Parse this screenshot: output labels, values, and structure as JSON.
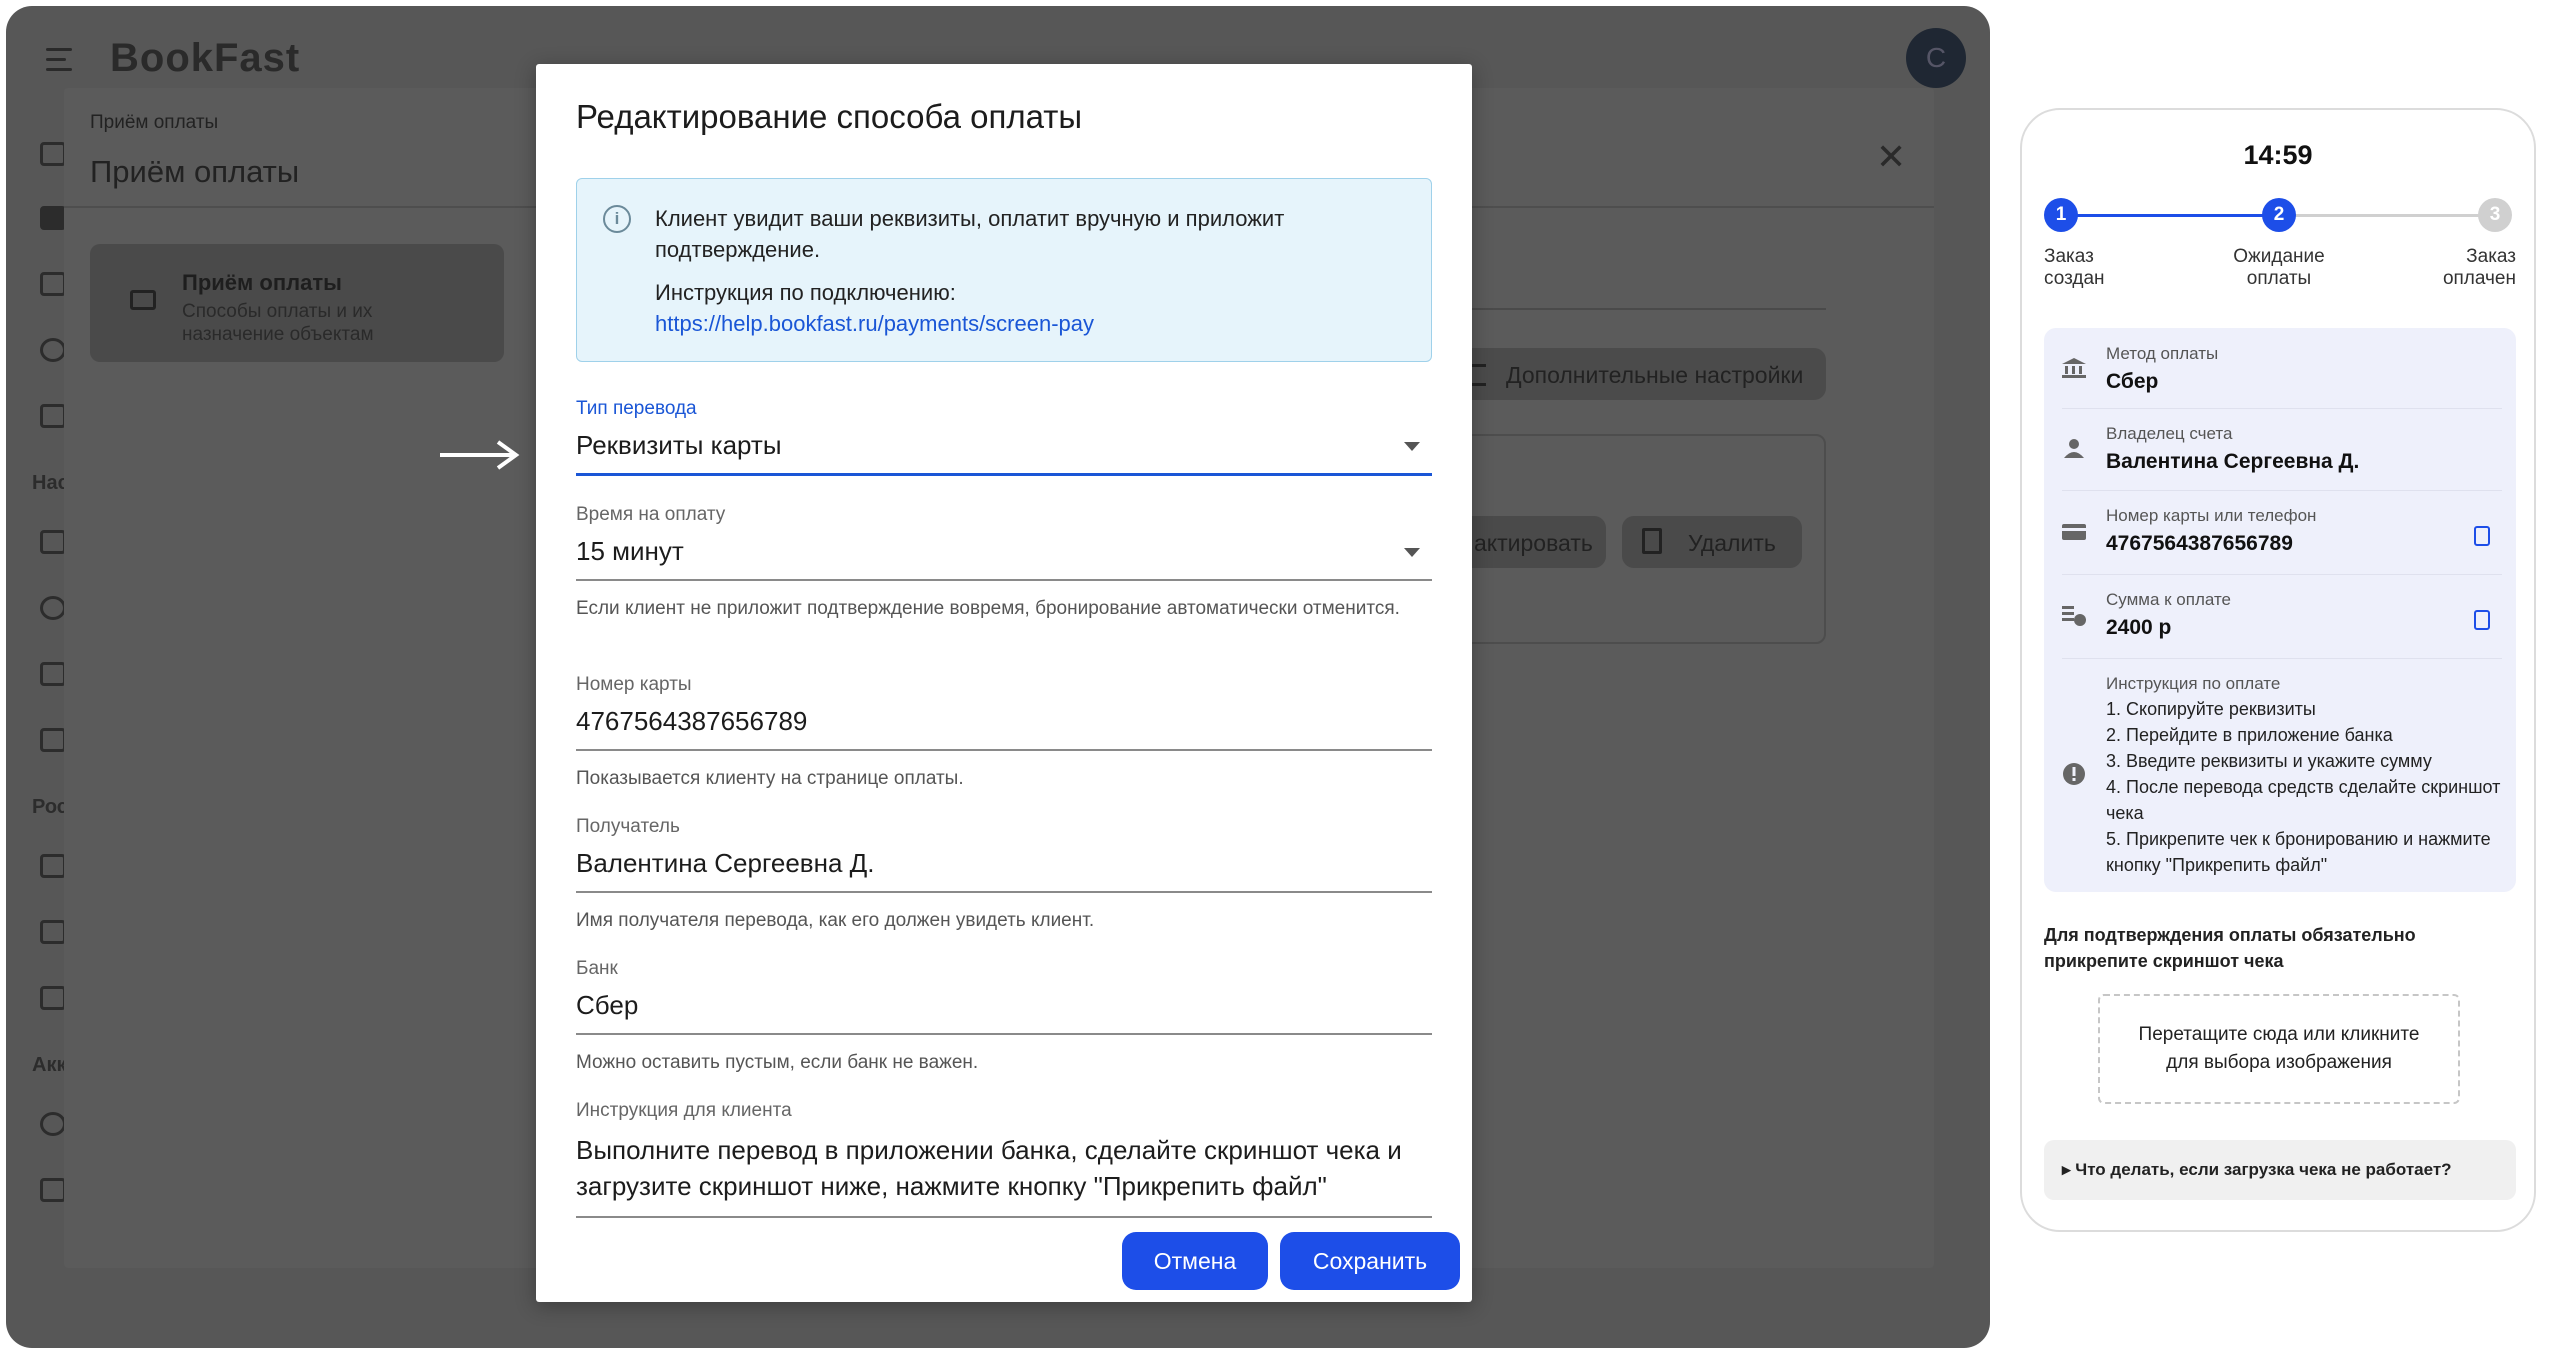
{
  "app": {
    "brand": "BookFast",
    "avatar_letter": "C"
  },
  "sidebar": {
    "section_1": "Нас",
    "section_2": "Рос",
    "section_3": "Акк"
  },
  "background_page": {
    "breadcrumb": "Приём оплаты",
    "title": "Приём оплаты",
    "card_title": "Приём оплаты",
    "card_subtitle": "Способы оплаты и их назначение объектам",
    "advanced_settings": "Дополнительные настройки",
    "edit_partial": "актировать",
    "delete": "Удалить"
  },
  "modal": {
    "title": "Редактирование способа оплаты",
    "info_text": "Клиент увидит ваши реквизиты, оплатит вручную и приложит подтверждение.",
    "info_instruction_label": "Инструкция по подключению:",
    "info_link": "https://help.bookfast.ru/payments/screen-pay",
    "transfer_type": {
      "label": "Тип перевода",
      "value": "Реквизиты карты"
    },
    "payment_time": {
      "label": "Время на оплату",
      "value": "15 минут",
      "help": "Если клиент не приложит подтверждение вовремя, бронирование автоматически отменится."
    },
    "card_number": {
      "label": "Номер карты",
      "value": "4767564387656789",
      "help": "Показывается клиенту на странице оплаты."
    },
    "recipient": {
      "label": "Получатель",
      "value": "Валентина Сергеевна Д.",
      "help": "Имя получателя перевода, как его должен увидеть клиент."
    },
    "bank": {
      "label": "Банк",
      "value": "Сбер",
      "help": "Можно оставить пустым, если банк не важен."
    },
    "client_instruction": {
      "label": "Инструкция для клиента",
      "value": "Выполните перевод в приложении банка, сделайте скриншот чека и загрузите скриншот ниже, нажмите кнопку \"Прикрепить файл\""
    },
    "cancel_label": "Отмена",
    "save_label": "Сохранить"
  },
  "phone": {
    "time": "14:59",
    "steps": [
      {
        "number": "1",
        "label": "Заказ создан",
        "color": "#1d4ee8"
      },
      {
        "number": "2",
        "label": "Ожидание оплаты",
        "color": "#1d4ee8"
      },
      {
        "number": "3",
        "label": "Заказ оплачен",
        "color": "#d0d0d0"
      }
    ],
    "method": {
      "label": "Метод оплаты",
      "value": "Сбер"
    },
    "owner": {
      "label": "Владелец счета",
      "value": "Валентина Сергеевна Д."
    },
    "card": {
      "label": "Номер карты или телефон",
      "value": "4767564387656789"
    },
    "amount": {
      "label": "Сумма к оплате",
      "value": "2400 р"
    },
    "instructions_label": "Инструкция по оплате",
    "instructions": [
      "1. Скопируйте реквизиты",
      "2. Перейдите в приложение банка",
      "3. Введите реквизиты и укажите сумму",
      "4. После перевода средств сделайте скриншот чека",
      "5. Прикрепите чек к бронированию и нажмите кнопку \"Прикрепить файл\""
    ],
    "confirm_note": "Для подтверждения оплаты обязательно прикрепите скриншот чека",
    "drop_zone": "Перетащите сюда или кликните для выбора изображения",
    "faq": "▸ Что делать, если загрузка чека не работает?"
  },
  "colors": {
    "accent": "#1d4ee8",
    "info_bg": "#e6f4fb",
    "overlay": "#575757"
  }
}
